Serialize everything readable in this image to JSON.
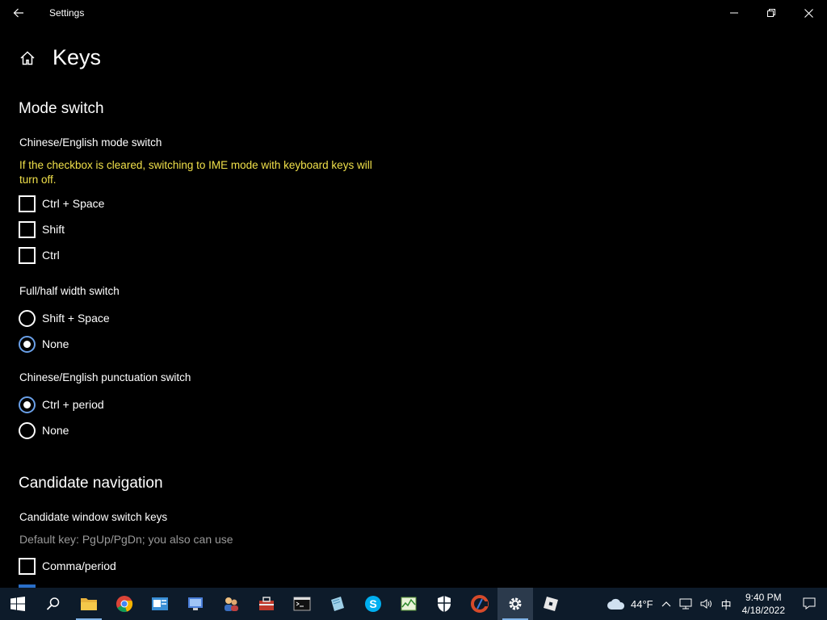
{
  "window": {
    "title": "Settings",
    "back_icon": "back-arrow-icon",
    "controls": [
      "minimize-icon",
      "restore-icon",
      "close-icon"
    ]
  },
  "page": {
    "title": "Keys",
    "home_icon": "home-icon"
  },
  "mode_switch": {
    "section_title": "Mode switch",
    "cn_en_label": "Chinese/English mode switch",
    "warning": "If the checkbox is cleared, switching to IME mode with keyboard keys will turn off.",
    "checkboxes": [
      {
        "label": "Ctrl + Space",
        "checked": false
      },
      {
        "label": "Shift",
        "checked": false
      },
      {
        "label": "Ctrl",
        "checked": false
      }
    ],
    "width_label": "Full/half width switch",
    "width_options": [
      {
        "label": "Shift + Space",
        "selected": false
      },
      {
        "label": "None",
        "selected": true
      }
    ],
    "punct_label": "Chinese/English punctuation switch",
    "punct_options": [
      {
        "label": "Ctrl + period",
        "selected": true
      },
      {
        "label": "None",
        "selected": false
      }
    ]
  },
  "candidate_navigation": {
    "section_title": "Candidate navigation",
    "switch_keys_label": "Candidate window switch keys",
    "hint": "Default key: PgUp/PgDn; you also can use",
    "checkboxes": [
      {
        "label": "Comma/period",
        "checked": false
      }
    ]
  },
  "taskbar": {
    "apps": [
      "start-icon",
      "search-icon",
      "file-explorer-icon",
      "chrome-icon",
      "outlook-icon",
      "remote-desktop-icon",
      "people-icon",
      "toolbox-icon",
      "terminal-icon",
      "notepad-icon",
      "skype-icon",
      "task-manager-icon",
      "security-icon",
      "ccleaner-icon",
      "settings-icon",
      "roblox-icon"
    ],
    "active_app": "settings-icon",
    "weather": {
      "temp": "44°F",
      "icon": "cloud-icon"
    },
    "tray_icons": [
      "chevron-up-icon",
      "network-icon",
      "volume-icon"
    ],
    "ime_indicator": "中",
    "time": "9:40 PM",
    "date": "4/18/2022",
    "notification_icon": "notification-icon"
  },
  "colors": {
    "background": "#000000",
    "warning": "#f0e04a",
    "accent": "#6aa0e8",
    "taskbar": "#0d1b2a"
  }
}
